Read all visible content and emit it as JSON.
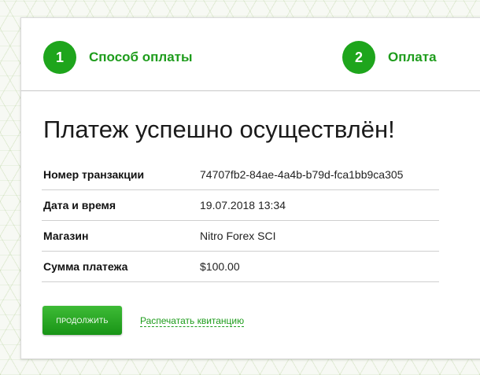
{
  "colors": {
    "accent": "#1ea51c",
    "text": "#1a1a1a",
    "background": "#ffffff"
  },
  "steps": [
    {
      "number": "1",
      "label": "Способ оплаты"
    },
    {
      "number": "2",
      "label": "Оплата"
    }
  ],
  "title": "Платеж успешно осуществлён!",
  "details": [
    {
      "label": "Номер транзакции",
      "value": "74707fb2-84ae-4a4b-b79d-fca1bb9ca305"
    },
    {
      "label": "Дата и время",
      "value": "19.07.2018 13:34"
    },
    {
      "label": "Магазин",
      "value": "Nitro Forex SCI"
    },
    {
      "label": "Сумма платежа",
      "value": "$100.00"
    }
  ],
  "actions": {
    "continue_label": "ПРОДОЛЖИТЬ",
    "print_label": "Распечатать квитанцию"
  }
}
